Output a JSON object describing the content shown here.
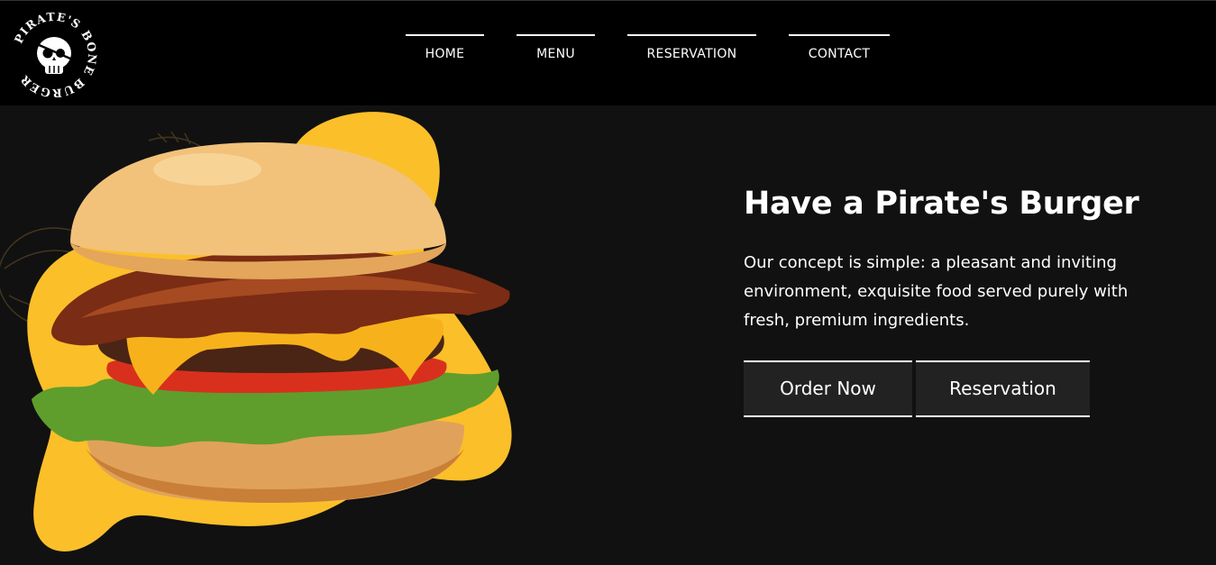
{
  "brand": {
    "logo_text": "PIRATE'S BONE BURGER",
    "logo_icon": "skull-eyepatch-icon"
  },
  "nav": {
    "items": [
      {
        "label": "HOME"
      },
      {
        "label": "MENU"
      },
      {
        "label": "RESERVATION"
      },
      {
        "label": "CONTACT"
      }
    ]
  },
  "hero": {
    "title": "Have a Pirate's Burger",
    "description": "Our concept is simple: a pleasant and inviting environment, exquisite food served purely with fresh, premium ingredients.",
    "buttons": {
      "order": "Order Now",
      "reservation": "Reservation"
    },
    "image": "burger-image"
  },
  "colors": {
    "header_bg": "#000000",
    "page_bg": "#111111",
    "accent_yellow": "#fbbf2a",
    "button_bg": "#222222",
    "text": "#ffffff"
  }
}
